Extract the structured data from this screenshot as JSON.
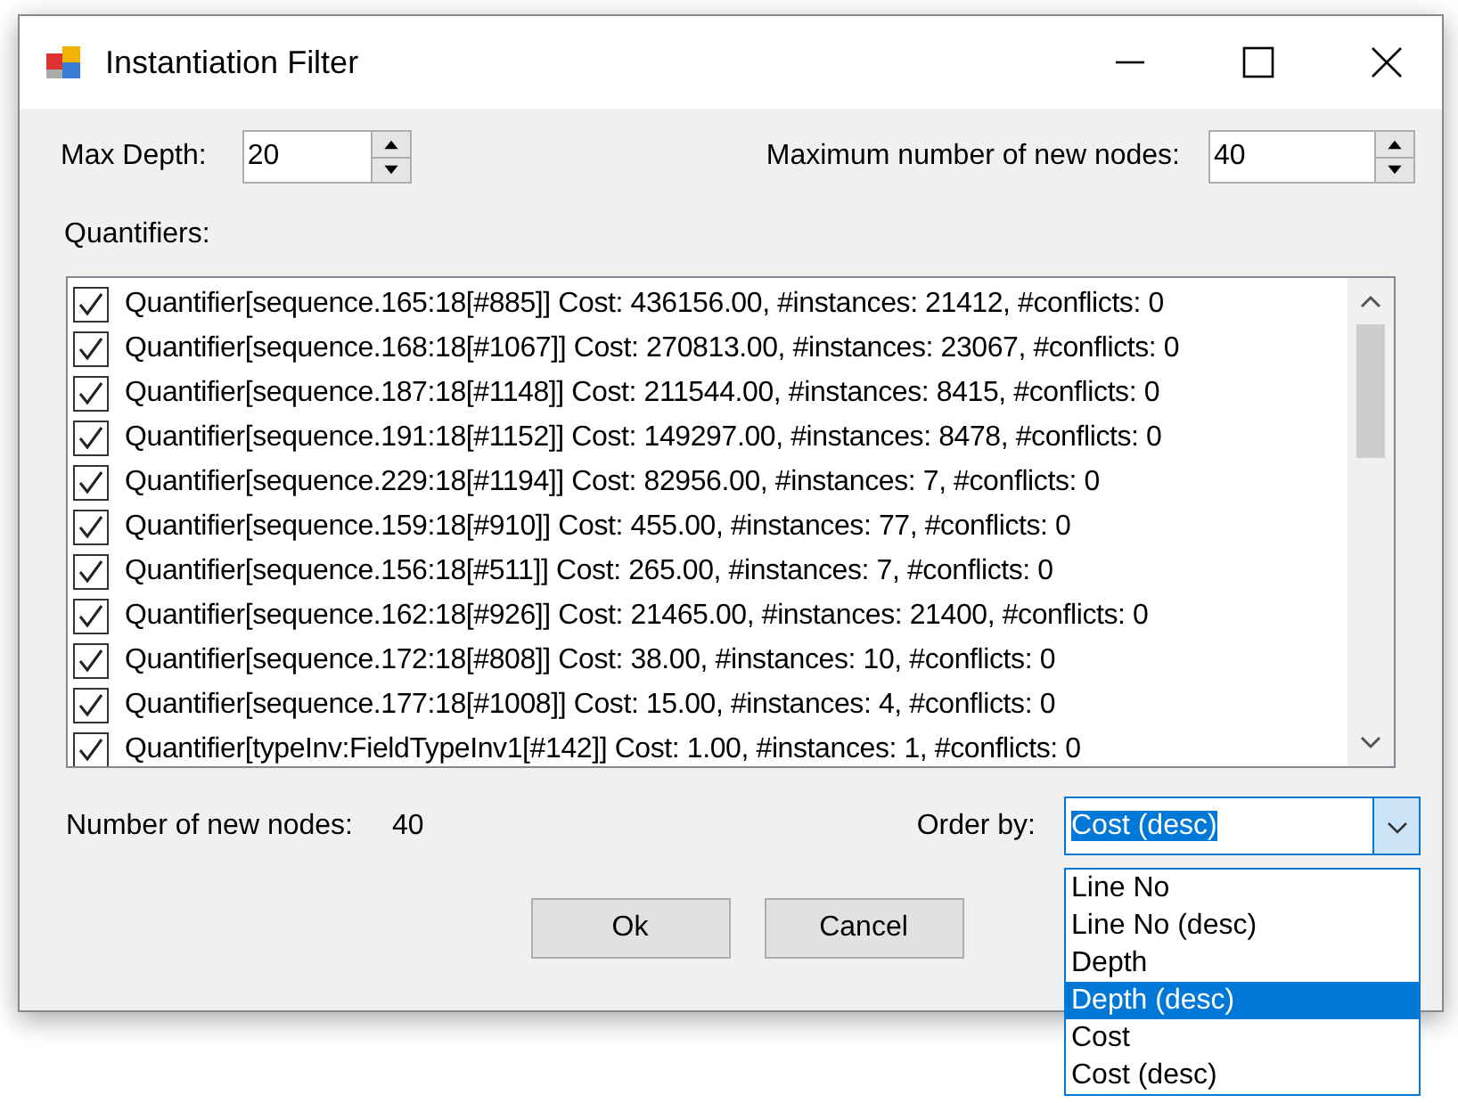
{
  "window": {
    "title": "Instantiation Filter"
  },
  "max_depth": {
    "label": "Max Depth:",
    "value": "20"
  },
  "max_new_nodes": {
    "label": "Maximum number of new nodes:",
    "value": "40"
  },
  "quantifiers": {
    "label": "Quantifiers:",
    "items": [
      {
        "text": "Quantifier[sequence.165:18[#885]] Cost: 436156.00, #instances: 21412, #conflicts: 0",
        "checked": true
      },
      {
        "text": "Quantifier[sequence.168:18[#1067]] Cost: 270813.00, #instances: 23067, #conflicts: 0",
        "checked": true
      },
      {
        "text": "Quantifier[sequence.187:18[#1148]] Cost: 211544.00, #instances: 8415, #conflicts: 0",
        "checked": true
      },
      {
        "text": "Quantifier[sequence.191:18[#1152]] Cost: 149297.00, #instances: 8478, #conflicts: 0",
        "checked": true
      },
      {
        "text": "Quantifier[sequence.229:18[#1194]] Cost: 82956.00, #instances: 7, #conflicts: 0",
        "checked": true
      },
      {
        "text": "Quantifier[sequence.159:18[#910]] Cost: 455.00, #instances: 77, #conflicts: 0",
        "checked": true
      },
      {
        "text": "Quantifier[sequence.156:18[#511]] Cost: 265.00, #instances: 7, #conflicts: 0",
        "checked": true
      },
      {
        "text": "Quantifier[sequence.162:18[#926]] Cost: 21465.00, #instances: 21400, #conflicts: 0",
        "checked": true
      },
      {
        "text": "Quantifier[sequence.172:18[#808]] Cost: 38.00, #instances: 10, #conflicts: 0",
        "checked": true
      },
      {
        "text": "Quantifier[sequence.177:18[#1008]] Cost: 15.00, #instances: 4, #conflicts: 0",
        "checked": true
      },
      {
        "text": "Quantifier[typeInv:FieldTypeInv1[#142]] Cost: 1.00, #instances: 1, #conflicts: 0",
        "checked": true
      }
    ]
  },
  "new_nodes": {
    "label": "Number of new nodes:",
    "value": "40"
  },
  "order_by": {
    "label": "Order by:",
    "value": "Cost (desc)",
    "expanded": true,
    "options": [
      {
        "label": "Line No",
        "highlighted": false
      },
      {
        "label": "Line No (desc)",
        "highlighted": false
      },
      {
        "label": "Depth",
        "highlighted": false
      },
      {
        "label": "Depth (desc)",
        "highlighted": true
      },
      {
        "label": "Cost",
        "highlighted": false
      },
      {
        "label": "Cost (desc)",
        "highlighted": false
      }
    ]
  },
  "buttons": [
    "Ok",
    "Cancel"
  ]
}
